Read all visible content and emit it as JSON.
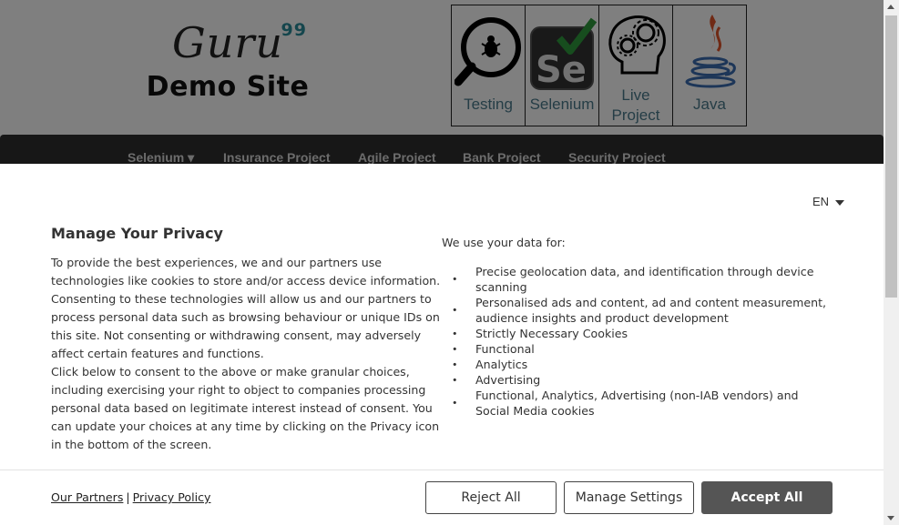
{
  "site": {
    "logo_text": "Guru",
    "logo_sup": "99",
    "subtitle": "Demo Site",
    "tiles": [
      {
        "label": "Testing",
        "icon": "magnifier-bug-icon"
      },
      {
        "label": "Selenium",
        "icon": "selenium-logo-icon"
      },
      {
        "label": "Live Project",
        "icon": "gear-head-icon"
      },
      {
        "label": "Java",
        "icon": "java-logo-icon"
      }
    ],
    "nav": [
      "Selenium",
      "Insurance Project",
      "Agile Project",
      "Bank Project",
      "Security Project"
    ]
  },
  "consent": {
    "language": "EN",
    "title": "Manage Your Privacy",
    "intro_1": "To provide the best experiences, we and our partners use technologies like cookies to store and/or access device information. Consenting to these technologies will allow us and our partners to process personal data such as browsing behaviour or unique IDs on this site. Not consenting or withdrawing consent, may adversely affect certain features and functions.",
    "intro_2": "Click below to consent to the above or make granular choices, including exercising your right to object to companies processing personal data based on legitimate interest instead of consent. You can update your choices at any time by clicking on the Privacy icon in the bottom of the screen.",
    "uses_title": "We use your data for:",
    "uses": [
      "Precise geolocation data, and identification through device scanning",
      "Personalised ads and content, ad and content measurement, audience insights and product development",
      "Strictly Necessary Cookies",
      "Functional",
      "Analytics",
      "Advertising",
      "Functional, Analytics, Advertising (non-IAB vendors) and Social Media cookies"
    ],
    "links": {
      "partners": "Our Partners",
      "separator": "|",
      "privacy": "Privacy Policy"
    },
    "buttons": {
      "reject": "Reject All",
      "manage": "Manage Settings",
      "accept": "Accept All"
    }
  }
}
